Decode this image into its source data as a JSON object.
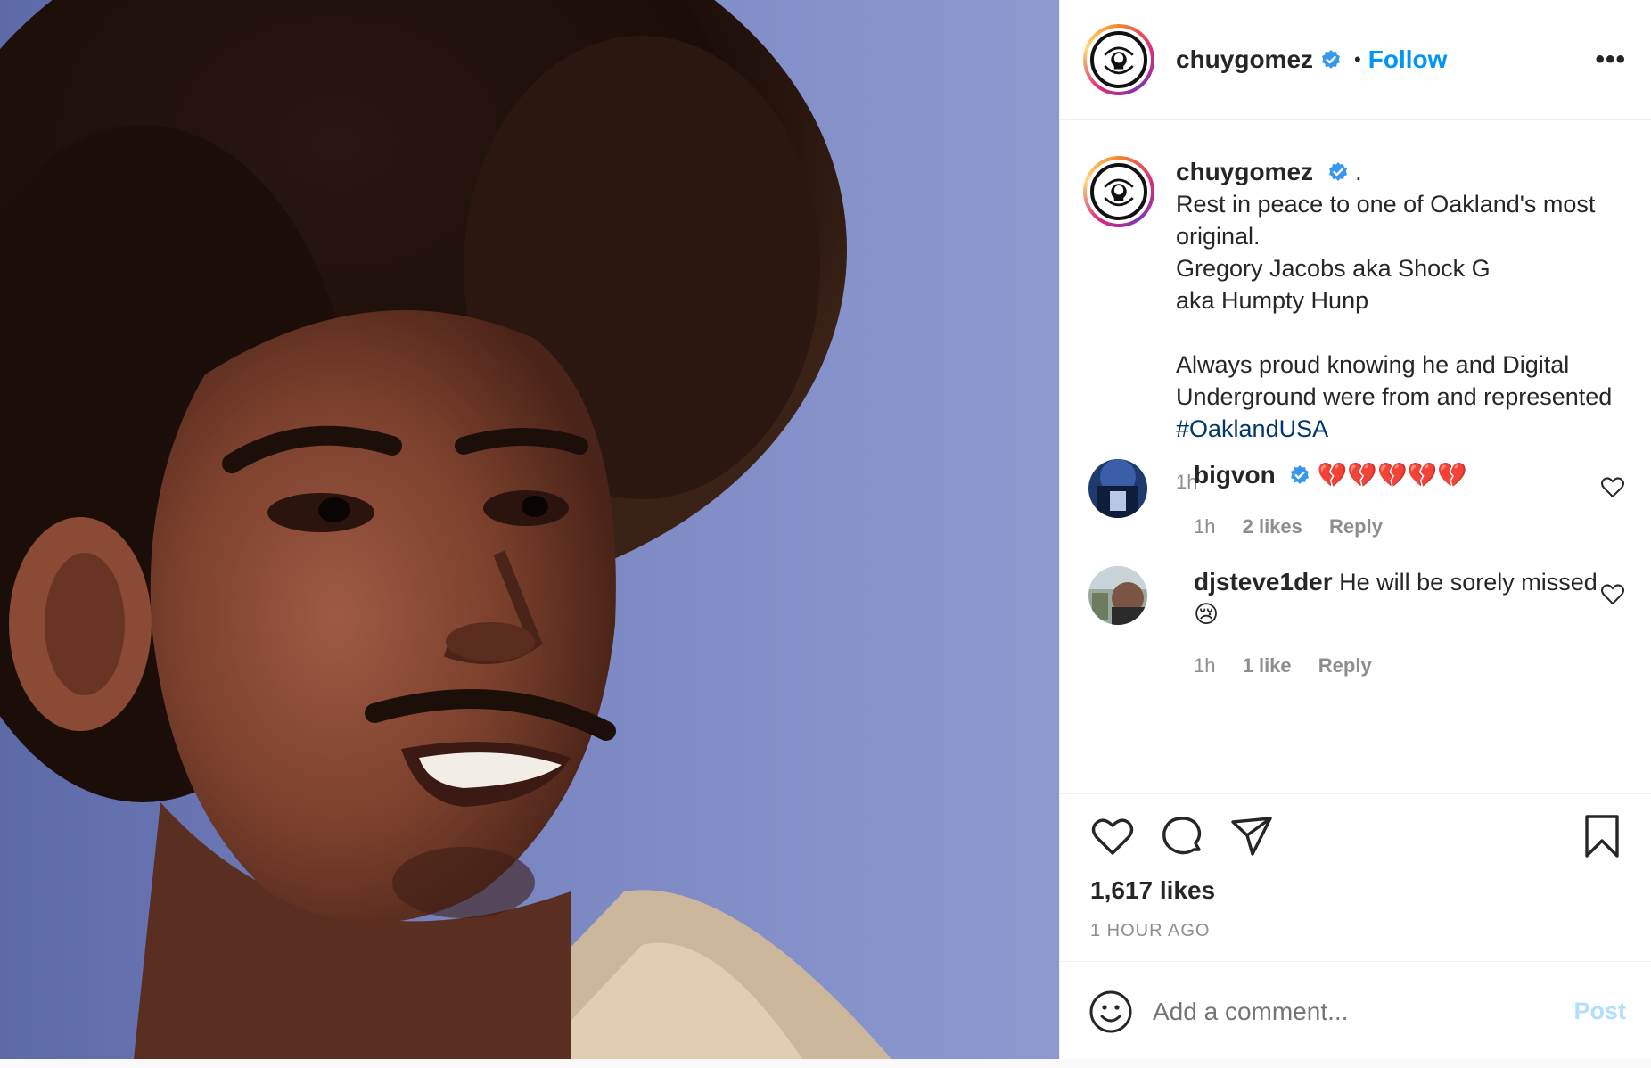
{
  "post": {
    "username": "chuygomez",
    "verified": true,
    "follow_label": "Follow",
    "more_icon": "more-horizontal-icon",
    "caption": {
      "username": "chuygomez",
      "suffix": ".",
      "text_lines": [
        "Rest in peace to one of Oakland's most original.",
        "Gregory Jacobs aka Shock G",
        "aka Humpty Hunp",
        "",
        "Always proud knowing he and Digital Underground were from and represented "
      ],
      "hashtag": "#OaklandUSA",
      "time": "1h"
    },
    "comments": [
      {
        "username": "bigvon",
        "verified": true,
        "text": "💔💔💔💔💔",
        "time": "1h",
        "likes": "2 likes",
        "reply": "Reply"
      },
      {
        "username": "djsteve1der",
        "verified": false,
        "text": "He will be sorely missed 😢",
        "time": "1h",
        "likes": "1 like",
        "reply": "Reply"
      }
    ],
    "likes_count": "1,617 likes",
    "posted_ago": "1 HOUR AGO",
    "add_comment_placeholder": "Add a comment...",
    "post_button": "Post",
    "colors": {
      "accent": "#0095f6",
      "hashtag": "#00376b",
      "muted": "#8e8e8e",
      "post_disabled": "#b2dffc"
    }
  }
}
